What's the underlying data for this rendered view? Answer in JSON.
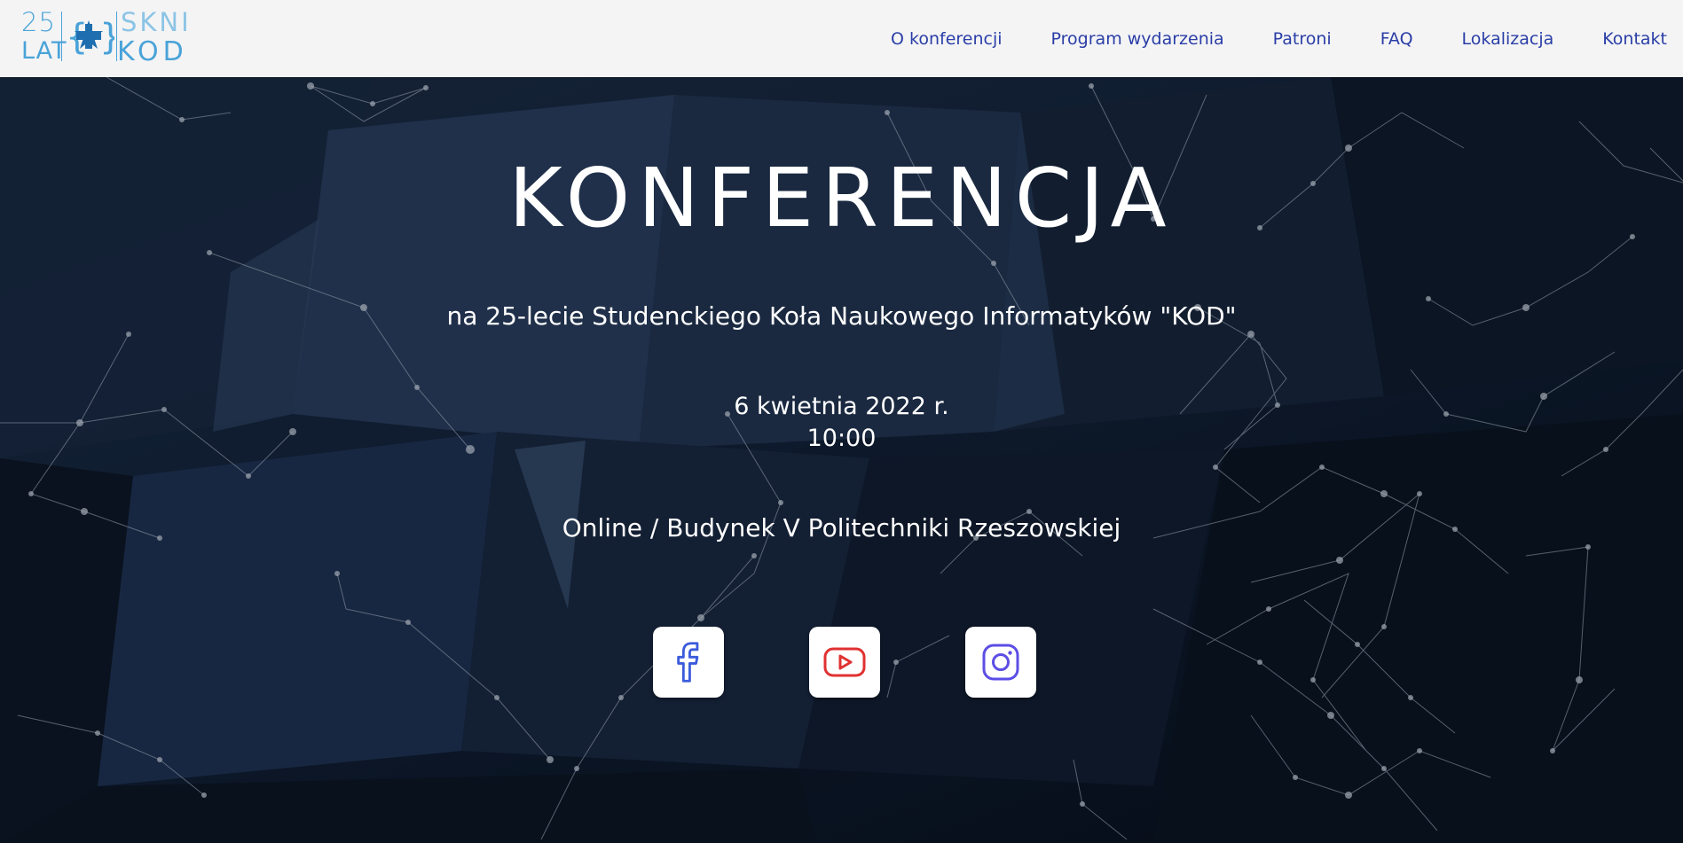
{
  "logo": {
    "years": "25",
    "years_label": "LAT",
    "org_top": "SKNI",
    "org_bottom": "KOD"
  },
  "nav": {
    "items": [
      {
        "label": "O konferencji"
      },
      {
        "label": "Program wydarzenia"
      },
      {
        "label": "Patroni"
      },
      {
        "label": "FAQ"
      },
      {
        "label": "Lokalizacja"
      },
      {
        "label": "Kontakt"
      }
    ]
  },
  "hero": {
    "title": "KONFERENCJA",
    "subtitle": "na 25-lecie Studenckiego Koła Naukowego Informatyków \"KOD\"",
    "date": "6 kwietnia 2022 r.",
    "time": "10:00",
    "location": "Online / Budynek V Politechniki Rzeszowskiej"
  },
  "socials": [
    {
      "icon": "facebook-icon",
      "color": "#3b5bdb"
    },
    {
      "icon": "youtube-icon",
      "color": "#e03131"
    },
    {
      "icon": "instagram-icon",
      "color": "#5c4ee5"
    }
  ],
  "colors": {
    "nav_link": "#2a3ea6",
    "logo_blue": "#4aa3d8",
    "header_bg": "#f4f4f5"
  }
}
